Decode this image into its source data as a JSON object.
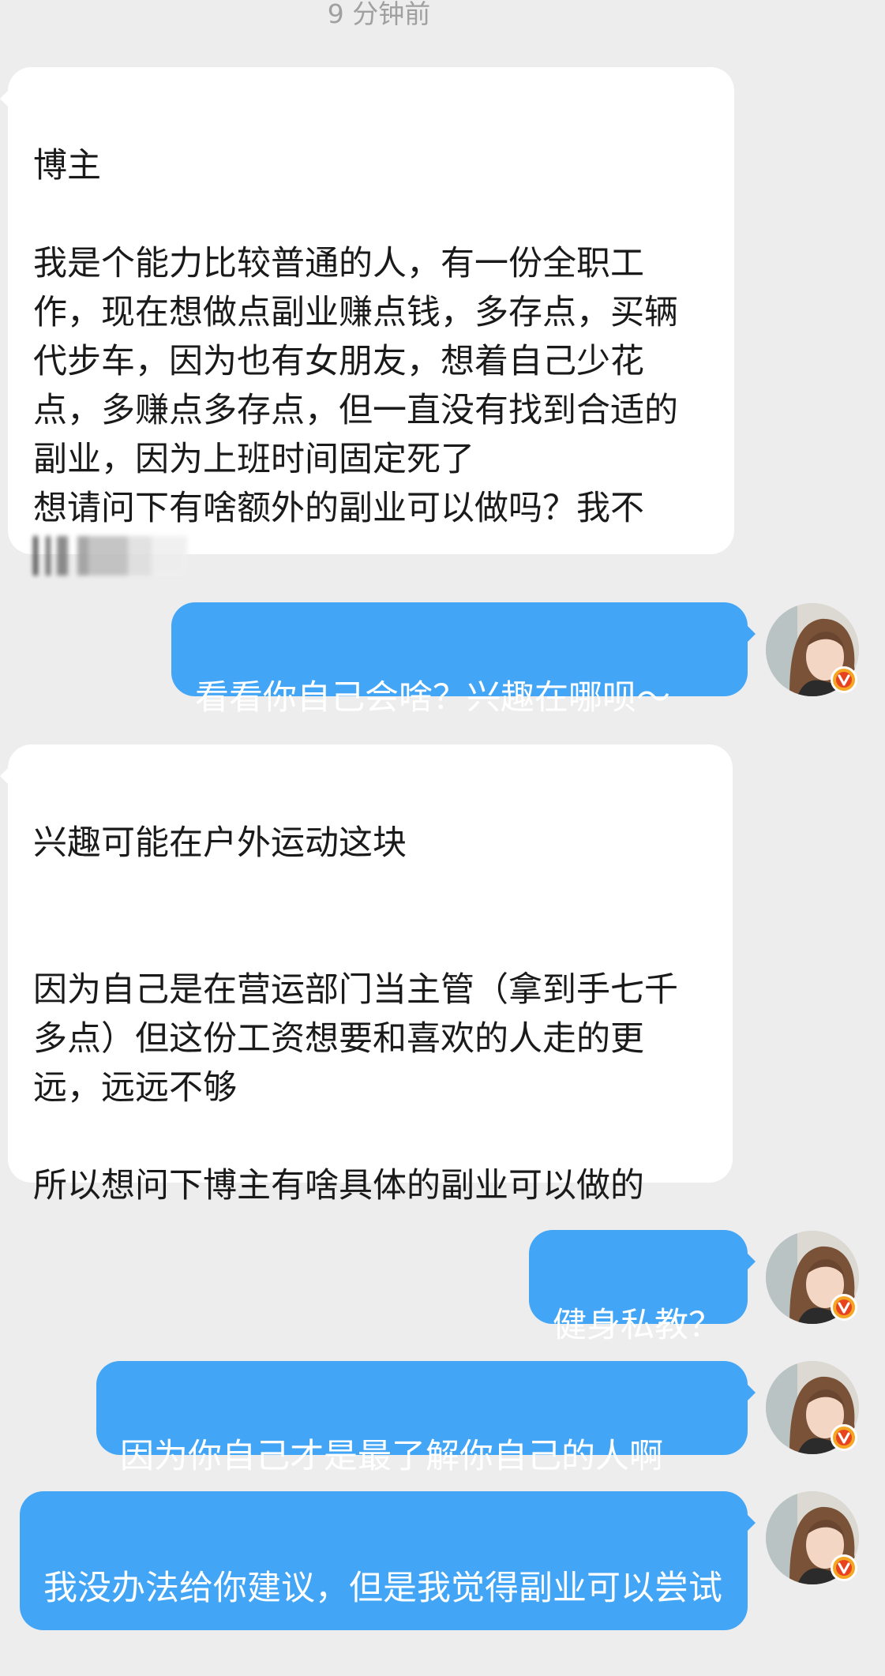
{
  "conversation": {
    "timestamp": "9 分钟前",
    "messages": [
      {
        "sender": "other",
        "text": "博主\n\n我是个能力比较普通的人，有一份全职工作，现在想做点副业赚点钱，多存点，买辆代步车，因为也有女朋友，想着自己少花点，多赚点多存点，但一直没有找到合适的副业，因为上班时间固定死了\n想请问下有啥额外的副业可以做吗？我不"
      },
      {
        "sender": "me",
        "text": "看看你自己会啥？兴趣在哪呗～"
      },
      {
        "sender": "other",
        "text": "兴趣可能在户外运动这块\n\n\n因为自己是在营运部门当主管（拿到手七千多点）但这份工资想要和喜欢的人走的更远，远远不够\n\n所以想问下博主有啥具体的副业可以做的"
      },
      {
        "sender": "me",
        "text": "健身私教？"
      },
      {
        "sender": "me",
        "text": "因为你自己才是最了解你自己的人啊"
      },
      {
        "sender": "me",
        "text": "我没办法给你建议，但是我觉得副业可以尝试"
      }
    ]
  },
  "avatar": {
    "icon": "user-avatar-photo",
    "badge_icon": "verified-v-icon",
    "badge_letter": "V"
  },
  "colors": {
    "background": "#ededed",
    "incoming_bubble": "#ffffff",
    "outgoing_bubble": "#42a5f5",
    "badge": "#e8431e"
  }
}
